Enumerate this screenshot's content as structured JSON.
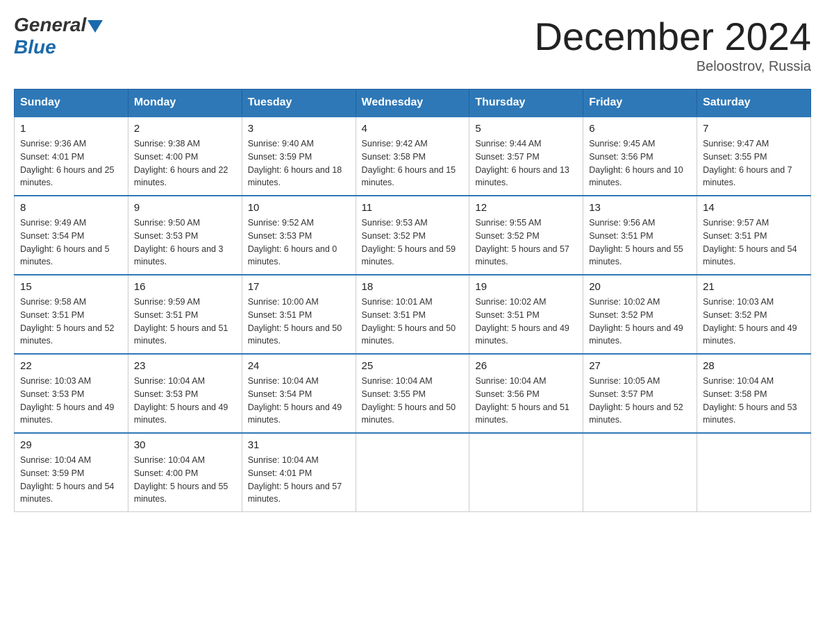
{
  "logo": {
    "general": "General",
    "blue": "Blue"
  },
  "title": "December 2024",
  "location": "Beloostrov, Russia",
  "headers": [
    "Sunday",
    "Monday",
    "Tuesday",
    "Wednesday",
    "Thursday",
    "Friday",
    "Saturday"
  ],
  "weeks": [
    [
      {
        "day": "1",
        "sunrise": "Sunrise: 9:36 AM",
        "sunset": "Sunset: 4:01 PM",
        "daylight": "Daylight: 6 hours and 25 minutes."
      },
      {
        "day": "2",
        "sunrise": "Sunrise: 9:38 AM",
        "sunset": "Sunset: 4:00 PM",
        "daylight": "Daylight: 6 hours and 22 minutes."
      },
      {
        "day": "3",
        "sunrise": "Sunrise: 9:40 AM",
        "sunset": "Sunset: 3:59 PM",
        "daylight": "Daylight: 6 hours and 18 minutes."
      },
      {
        "day": "4",
        "sunrise": "Sunrise: 9:42 AM",
        "sunset": "Sunset: 3:58 PM",
        "daylight": "Daylight: 6 hours and 15 minutes."
      },
      {
        "day": "5",
        "sunrise": "Sunrise: 9:44 AM",
        "sunset": "Sunset: 3:57 PM",
        "daylight": "Daylight: 6 hours and 13 minutes."
      },
      {
        "day": "6",
        "sunrise": "Sunrise: 9:45 AM",
        "sunset": "Sunset: 3:56 PM",
        "daylight": "Daylight: 6 hours and 10 minutes."
      },
      {
        "day": "7",
        "sunrise": "Sunrise: 9:47 AM",
        "sunset": "Sunset: 3:55 PM",
        "daylight": "Daylight: 6 hours and 7 minutes."
      }
    ],
    [
      {
        "day": "8",
        "sunrise": "Sunrise: 9:49 AM",
        "sunset": "Sunset: 3:54 PM",
        "daylight": "Daylight: 6 hours and 5 minutes."
      },
      {
        "day": "9",
        "sunrise": "Sunrise: 9:50 AM",
        "sunset": "Sunset: 3:53 PM",
        "daylight": "Daylight: 6 hours and 3 minutes."
      },
      {
        "day": "10",
        "sunrise": "Sunrise: 9:52 AM",
        "sunset": "Sunset: 3:53 PM",
        "daylight": "Daylight: 6 hours and 0 minutes."
      },
      {
        "day": "11",
        "sunrise": "Sunrise: 9:53 AM",
        "sunset": "Sunset: 3:52 PM",
        "daylight": "Daylight: 5 hours and 59 minutes."
      },
      {
        "day": "12",
        "sunrise": "Sunrise: 9:55 AM",
        "sunset": "Sunset: 3:52 PM",
        "daylight": "Daylight: 5 hours and 57 minutes."
      },
      {
        "day": "13",
        "sunrise": "Sunrise: 9:56 AM",
        "sunset": "Sunset: 3:51 PM",
        "daylight": "Daylight: 5 hours and 55 minutes."
      },
      {
        "day": "14",
        "sunrise": "Sunrise: 9:57 AM",
        "sunset": "Sunset: 3:51 PM",
        "daylight": "Daylight: 5 hours and 54 minutes."
      }
    ],
    [
      {
        "day": "15",
        "sunrise": "Sunrise: 9:58 AM",
        "sunset": "Sunset: 3:51 PM",
        "daylight": "Daylight: 5 hours and 52 minutes."
      },
      {
        "day": "16",
        "sunrise": "Sunrise: 9:59 AM",
        "sunset": "Sunset: 3:51 PM",
        "daylight": "Daylight: 5 hours and 51 minutes."
      },
      {
        "day": "17",
        "sunrise": "Sunrise: 10:00 AM",
        "sunset": "Sunset: 3:51 PM",
        "daylight": "Daylight: 5 hours and 50 minutes."
      },
      {
        "day": "18",
        "sunrise": "Sunrise: 10:01 AM",
        "sunset": "Sunset: 3:51 PM",
        "daylight": "Daylight: 5 hours and 50 minutes."
      },
      {
        "day": "19",
        "sunrise": "Sunrise: 10:02 AM",
        "sunset": "Sunset: 3:51 PM",
        "daylight": "Daylight: 5 hours and 49 minutes."
      },
      {
        "day": "20",
        "sunrise": "Sunrise: 10:02 AM",
        "sunset": "Sunset: 3:52 PM",
        "daylight": "Daylight: 5 hours and 49 minutes."
      },
      {
        "day": "21",
        "sunrise": "Sunrise: 10:03 AM",
        "sunset": "Sunset: 3:52 PM",
        "daylight": "Daylight: 5 hours and 49 minutes."
      }
    ],
    [
      {
        "day": "22",
        "sunrise": "Sunrise: 10:03 AM",
        "sunset": "Sunset: 3:53 PM",
        "daylight": "Daylight: 5 hours and 49 minutes."
      },
      {
        "day": "23",
        "sunrise": "Sunrise: 10:04 AM",
        "sunset": "Sunset: 3:53 PM",
        "daylight": "Daylight: 5 hours and 49 minutes."
      },
      {
        "day": "24",
        "sunrise": "Sunrise: 10:04 AM",
        "sunset": "Sunset: 3:54 PM",
        "daylight": "Daylight: 5 hours and 49 minutes."
      },
      {
        "day": "25",
        "sunrise": "Sunrise: 10:04 AM",
        "sunset": "Sunset: 3:55 PM",
        "daylight": "Daylight: 5 hours and 50 minutes."
      },
      {
        "day": "26",
        "sunrise": "Sunrise: 10:04 AM",
        "sunset": "Sunset: 3:56 PM",
        "daylight": "Daylight: 5 hours and 51 minutes."
      },
      {
        "day": "27",
        "sunrise": "Sunrise: 10:05 AM",
        "sunset": "Sunset: 3:57 PM",
        "daylight": "Daylight: 5 hours and 52 minutes."
      },
      {
        "day": "28",
        "sunrise": "Sunrise: 10:04 AM",
        "sunset": "Sunset: 3:58 PM",
        "daylight": "Daylight: 5 hours and 53 minutes."
      }
    ],
    [
      {
        "day": "29",
        "sunrise": "Sunrise: 10:04 AM",
        "sunset": "Sunset: 3:59 PM",
        "daylight": "Daylight: 5 hours and 54 minutes."
      },
      {
        "day": "30",
        "sunrise": "Sunrise: 10:04 AM",
        "sunset": "Sunset: 4:00 PM",
        "daylight": "Daylight: 5 hours and 55 minutes."
      },
      {
        "day": "31",
        "sunrise": "Sunrise: 10:04 AM",
        "sunset": "Sunset: 4:01 PM",
        "daylight": "Daylight: 5 hours and 57 minutes."
      },
      null,
      null,
      null,
      null
    ]
  ]
}
